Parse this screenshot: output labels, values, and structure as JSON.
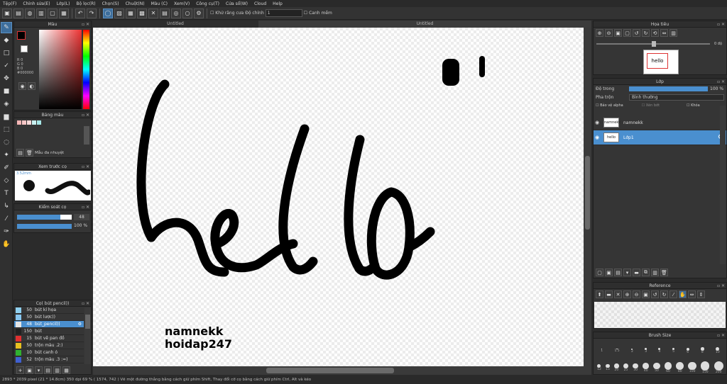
{
  "menu": [
    "Tệp(F)",
    "Chỉnh sửa(E)",
    "Lớp(L)",
    "Bộ lọc(R)",
    "Chọn(S)",
    "Chuột(N)",
    "Màu (C)",
    "Xem(V)",
    "Công cụ(T)",
    "Cửa sổ(W)",
    "Cloud",
    "Help"
  ],
  "toolbar": {
    "antialias_label": "Khử răng cưa",
    "stabilizer_label": "Độ chính",
    "stabilizer_value": "1",
    "snap_label": "Canh mềm"
  },
  "tabs": {
    "left": "Untitled",
    "main": "Untitled"
  },
  "color_panel": {
    "title": "Màu",
    "rgb": [
      "R 0",
      "G 0",
      "B 0"
    ],
    "hex": "#000000",
    "foreground": "#000000",
    "background": "#ffffff"
  },
  "palette_panel": {
    "title": "Bảng màu",
    "colors": [
      "#f4b6b6",
      "#f7c6c6",
      "#fbd9d9",
      "#c9f0f0",
      "#a7e8e8"
    ],
    "add_label": "Mẫu đa nhuyệt"
  },
  "brush_preview_panel": {
    "title": "Xem trước cọ",
    "size_text": "3.52mm"
  },
  "brush_control_panel": {
    "title": "Kiểm soát cọ",
    "size_value": "48",
    "opacity_value": "100 %",
    "size_fill": 0.79,
    "opacity_fill": 1.0
  },
  "brush_list_panel": {
    "title": "Cọ( bút pencil))",
    "items": [
      {
        "color": "#8fd0f0",
        "size": "50",
        "name": "bút kí họa",
        "selected": false
      },
      {
        "color": "#87c6f0",
        "size": "50",
        "name": "bút lược))",
        "selected": false
      },
      {
        "color": "#e6e6e6",
        "size": "48",
        "name": "bút_pencil))",
        "selected": true
      },
      {
        "color": "#222222",
        "size": "150",
        "name": "bút",
        "selected": false
      },
      {
        "color": "#e03030",
        "size": "15",
        "name": "bút vẽ pan đồ",
        "selected": false
      },
      {
        "color": "#e8c020",
        "size": "50",
        "name": "trộn màu .2:)",
        "selected": false
      },
      {
        "color": "#30b030",
        "size": "10",
        "name": "bút canh ó",
        "selected": false
      },
      {
        "color": "#4060d0",
        "size": "52",
        "name": "trộn màu .3 :=)",
        "selected": false
      }
    ]
  },
  "navigator_panel": {
    "title": "Họa tiêu",
    "zoom_value": "0 độ"
  },
  "layer_panel": {
    "title": "Lớp",
    "opacity_label": "Độ trong",
    "opacity_value": "100 %",
    "blend_label": "Pha trộn",
    "blend_value": "Bình thường",
    "protect_alpha": "Bảo vệ alpha",
    "clipping": "Xén bớt",
    "lock": "Khóa",
    "layers": [
      {
        "name": "namnekk",
        "thumb": "namnekk",
        "selected": false
      },
      {
        "name": "Lớp1",
        "thumb": "hello",
        "selected": true
      }
    ]
  },
  "reference_panel": {
    "title": "Reference"
  },
  "brush_size_panel": {
    "title": "Brush Size",
    "top_labels": [
      "1",
      "1.5",
      "2",
      "3",
      "4",
      "5",
      "6",
      "8",
      "10"
    ],
    "bottom_labels": [
      "12",
      "15",
      "20",
      "25",
      "30",
      "40",
      "50",
      "60",
      "80",
      "100",
      "150",
      "200"
    ]
  },
  "canvas": {
    "signature_line1": "namnekk",
    "signature_line2": "hoidap247",
    "drawing_text": "hello"
  },
  "status": "2893 * 2039 pixel  (21 * 14.8cm)  350 dpi  69 %  ( 1574, 742 )  Vẽ một đường thẳng bằng cách giữ phím Shift, Thay đổi cỡ cọ bằng cách giữ phím Ctrl, Alt và kéo"
}
